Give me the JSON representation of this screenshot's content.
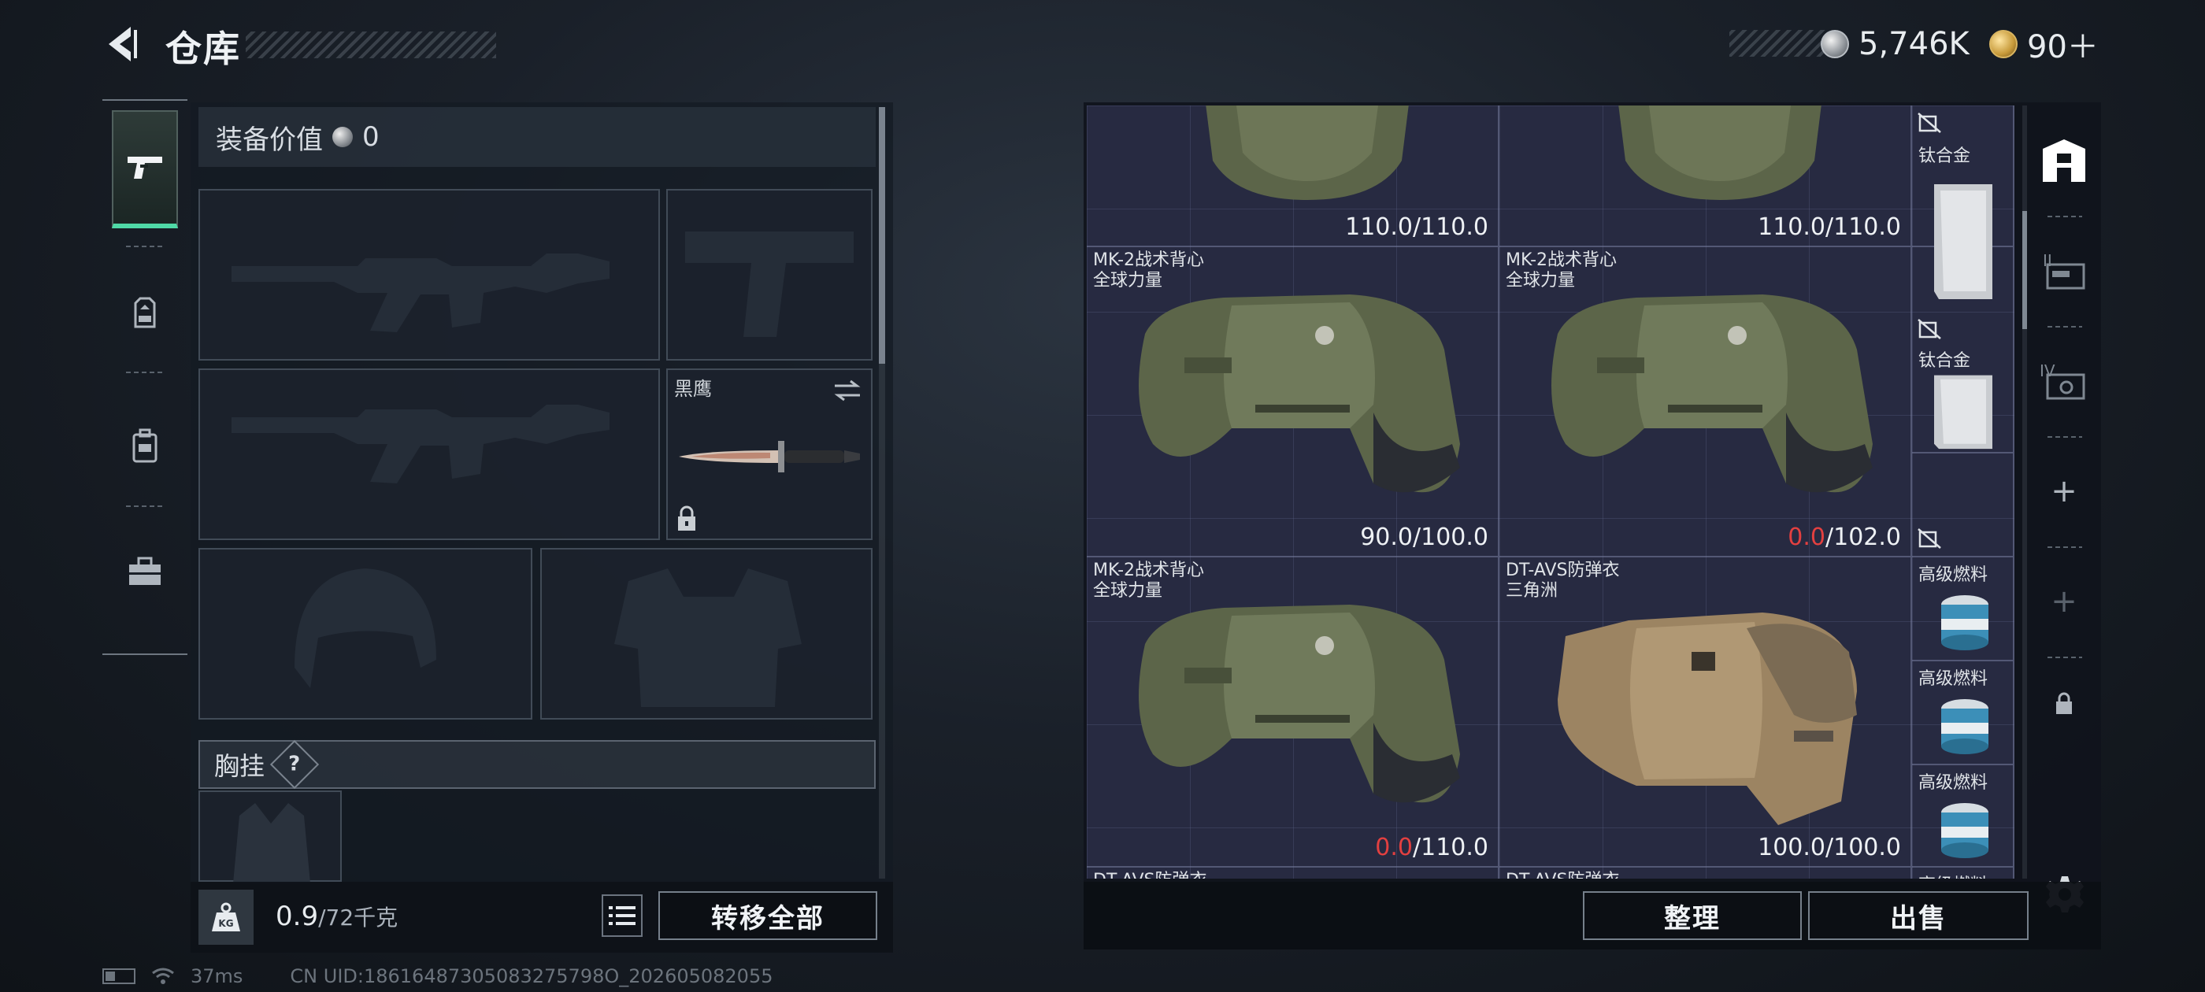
{
  "header": {
    "title": "仓库",
    "currency_silver": "5,746K",
    "currency_gold": "90＋"
  },
  "left_panel": {
    "equip_value_label": "装备价值",
    "equip_value": "0",
    "knife_slot_name": "黑鹰",
    "chest_label": "胸挂",
    "chest_help": "?",
    "weight_current": "0.9",
    "weight_max": "/72千克",
    "transfer_all": "转移全部"
  },
  "stash": {
    "cells": [
      {
        "name": "",
        "brand": "",
        "dur_cur": "110.0",
        "dur_max": "/110.0",
        "dur_broken": false
      },
      {
        "name": "",
        "brand": "",
        "dur_cur": "110.0",
        "dur_max": "/110.0",
        "dur_broken": false
      },
      {
        "name": "MK-2战术背心",
        "brand": "全球力量",
        "dur_cur": "90.0",
        "dur_max": "/100.0",
        "dur_broken": false
      },
      {
        "name": "MK-2战术背心",
        "brand": "全球力量",
        "dur_cur": "0.0",
        "dur_max": "/102.0",
        "dur_broken": true
      },
      {
        "name": "MK-2战术背心",
        "brand": "全球力量",
        "dur_cur": "0.0",
        "dur_max": "/110.0",
        "dur_broken": true
      },
      {
        "name": "DT-AVS防弹衣",
        "brand": "三角洲",
        "dur_cur": "100.0",
        "dur_max": "/100.0",
        "dur_broken": false
      },
      {
        "name": "DT-AVS防弹衣",
        "brand": ""
      },
      {
        "name": "DT-AVS防弹衣",
        "brand": ""
      }
    ],
    "small_items": [
      {
        "name": "钛合金"
      },
      {
        "name": "钛合金"
      },
      {
        "name": "高级燃料"
      },
      {
        "name": "高级燃料"
      },
      {
        "name": "高级燃料"
      },
      {
        "name": "高级燃料"
      }
    ],
    "organize": "整理",
    "sell": "出售"
  },
  "status": {
    "ping": "37ms",
    "uid": "CN UID:18616487305083275798O_202605082055"
  },
  "colors": {
    "accent_active": "#4fd9a6",
    "broken": "#e34040",
    "grid_bg": "#272a41"
  }
}
